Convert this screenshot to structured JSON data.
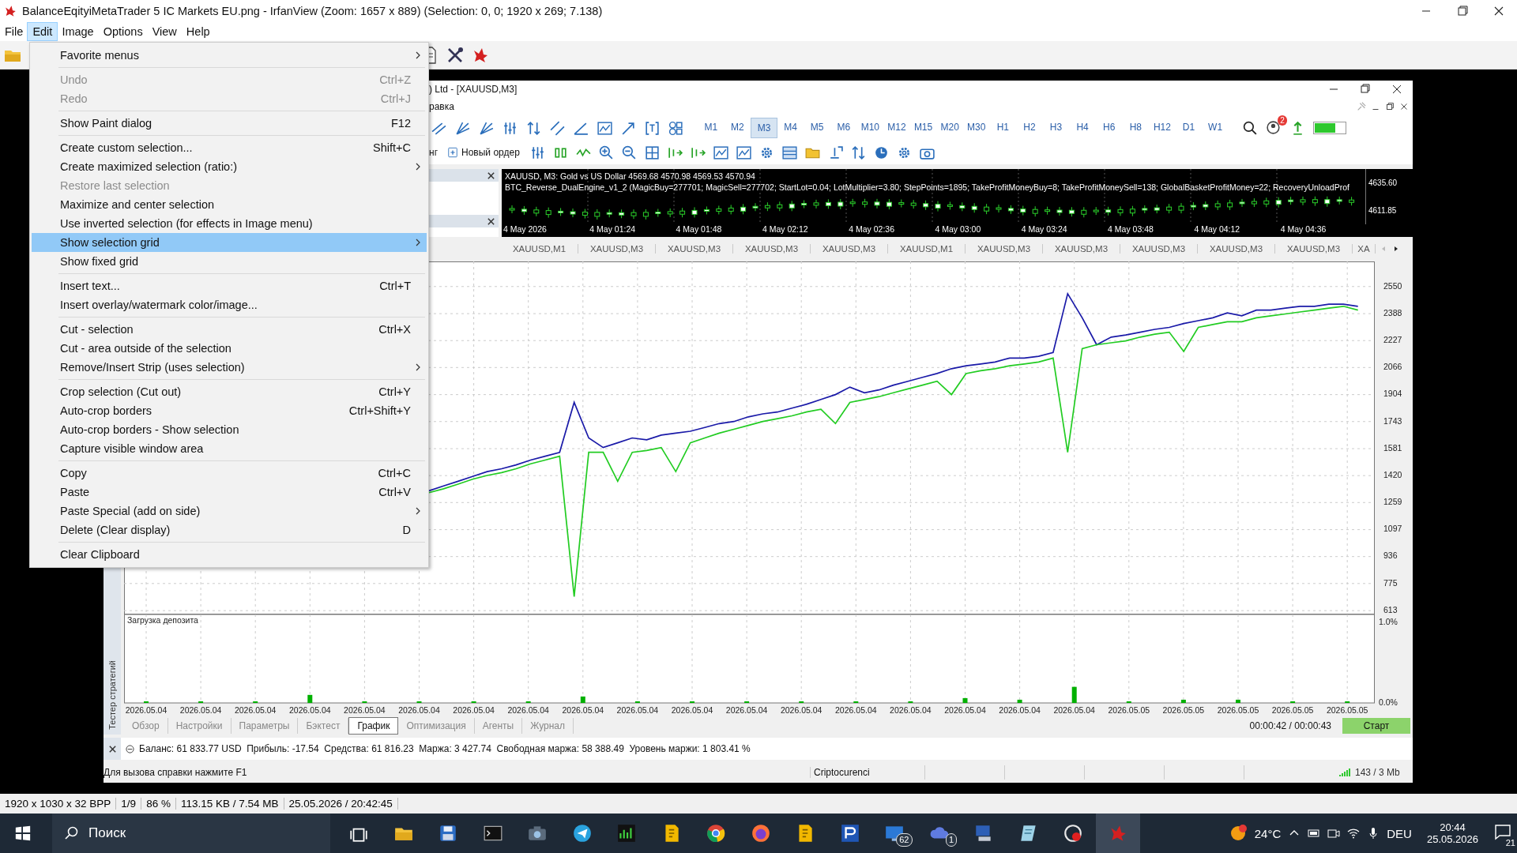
{
  "window": {
    "title": "BalanceEqityiMetaTrader 5 IC Markets EU.png - IrfanView (Zoom: 1657 x 889) (Selection: 0, 0; 1920 x 269; 7.138)"
  },
  "menu": [
    {
      "label": "File",
      "selected": false
    },
    {
      "label": "Edit",
      "selected": true
    },
    {
      "label": "Image",
      "selected": false
    },
    {
      "label": "Options",
      "selected": false
    },
    {
      "label": "View",
      "selected": false
    },
    {
      "label": "Help",
      "selected": false
    }
  ],
  "edit_menu": [
    {
      "kind": "item",
      "label": "Favorite menus",
      "submenu": true,
      "disabled": false,
      "selected": false
    },
    {
      "kind": "separator"
    },
    {
      "kind": "item",
      "label": "Undo",
      "shortcut": "Ctrl+Z",
      "submenu": false,
      "disabled": true,
      "selected": false
    },
    {
      "kind": "item",
      "label": "Redo",
      "shortcut": "Ctrl+J",
      "submenu": false,
      "disabled": true,
      "selected": false
    },
    {
      "kind": "separator"
    },
    {
      "kind": "item",
      "label": "Show Paint dialog",
      "shortcut": "F12",
      "submenu": false,
      "disabled": false,
      "selected": false
    },
    {
      "kind": "separator"
    },
    {
      "kind": "item",
      "label": "Create custom selection...",
      "shortcut": "Shift+C",
      "submenu": false,
      "disabled": false,
      "selected": false
    },
    {
      "kind": "item",
      "label": "Create maximized selection (ratio:)",
      "submenu": true,
      "disabled": false,
      "selected": false
    },
    {
      "kind": "item",
      "label": "Restore last selection",
      "submenu": false,
      "disabled": true,
      "selected": false
    },
    {
      "kind": "item",
      "label": "Maximize and center selection",
      "submenu": false,
      "disabled": false,
      "selected": false
    },
    {
      "kind": "item",
      "label": "Use inverted selection (for effects in Image menu)",
      "submenu": false,
      "disabled": false,
      "selected": false
    },
    {
      "kind": "item",
      "label": "Show selection grid",
      "submenu": true,
      "disabled": false,
      "selected": true
    },
    {
      "kind": "item",
      "label": "Show fixed grid",
      "submenu": false,
      "disabled": false,
      "selected": false
    },
    {
      "kind": "separator"
    },
    {
      "kind": "item",
      "label": "Insert text...",
      "shortcut": "Ctrl+T",
      "submenu": false,
      "disabled": false,
      "selected": false
    },
    {
      "kind": "item",
      "label": "Insert overlay/watermark color/image...",
      "submenu": false,
      "disabled": false,
      "selected": false
    },
    {
      "kind": "separator"
    },
    {
      "kind": "item",
      "label": "Cut - selection",
      "shortcut": "Ctrl+X",
      "submenu": false,
      "disabled": false,
      "selected": false
    },
    {
      "kind": "item",
      "label": "Cut - area outside of the selection",
      "submenu": false,
      "disabled": false,
      "selected": false
    },
    {
      "kind": "item",
      "label": "Remove/Insert Strip (uses selection)",
      "submenu": true,
      "disabled": false,
      "selected": false
    },
    {
      "kind": "separator"
    },
    {
      "kind": "item",
      "label": "Crop selection (Cut out)",
      "shortcut": "Ctrl+Y",
      "submenu": false,
      "disabled": false,
      "selected": false
    },
    {
      "kind": "item",
      "label": "Auto-crop borders",
      "shortcut": "Ctrl+Shift+Y",
      "submenu": false,
      "disabled": false,
      "selected": false
    },
    {
      "kind": "item",
      "label": "Auto-crop borders - Show selection",
      "submenu": false,
      "disabled": false,
      "selected": false
    },
    {
      "kind": "item",
      "label": "Capture visible window area",
      "submenu": false,
      "disabled": false,
      "selected": false
    },
    {
      "kind": "separator"
    },
    {
      "kind": "item",
      "label": "Copy",
      "shortcut": "Ctrl+C",
      "submenu": false,
      "disabled": false,
      "selected": false
    },
    {
      "kind": "item",
      "label": "Paste",
      "shortcut": "Ctrl+V",
      "submenu": false,
      "disabled": false,
      "selected": false
    },
    {
      "kind": "item",
      "label": "Paste Special (add on side)",
      "submenu": true,
      "disabled": false,
      "selected": false
    },
    {
      "kind": "item",
      "label": "Delete (Clear display)",
      "shortcut": "D",
      "submenu": false,
      "disabled": false,
      "selected": false
    },
    {
      "kind": "separator"
    },
    {
      "kind": "item",
      "label": "Clear Clipboard",
      "submenu": false,
      "disabled": false,
      "selected": false
    }
  ],
  "image": {
    "title": ") Ltd - [XAUUSD,M3]",
    "menu_fragment": "равка",
    "timeframes": [
      {
        "label": "M1",
        "selected": false
      },
      {
        "label": "M2",
        "selected": false
      },
      {
        "label": "M3",
        "selected": true
      },
      {
        "label": "M4",
        "selected": false
      },
      {
        "label": "M5",
        "selected": false
      },
      {
        "label": "M6",
        "selected": false
      },
      {
        "label": "M10",
        "selected": false
      },
      {
        "label": "M12",
        "selected": false
      },
      {
        "label": "M15",
        "selected": false
      },
      {
        "label": "M20",
        "selected": false
      },
      {
        "label": "M30",
        "selected": false
      },
      {
        "label": "H1",
        "selected": false
      },
      {
        "label": "H2",
        "selected": false
      },
      {
        "label": "H3",
        "selected": false
      },
      {
        "label": "H4",
        "selected": false
      },
      {
        "label": "H6",
        "selected": false
      },
      {
        "label": "H8",
        "selected": false
      },
      {
        "label": "H12",
        "selected": false
      },
      {
        "label": "D1",
        "selected": false
      },
      {
        "label": "W1",
        "selected": false
      }
    ],
    "notification_badge": "2",
    "toolbar_fragment": "нг",
    "new_order_button": "Новый ордер",
    "mini_chart": {
      "header": "XAUUSD, M3:  Gold vs US Dollar  4569.68 4570.98 4569.53 4570.94",
      "expert": "BTC_Reverse_DualEngine_v1_2 (MagicBuy=277701; MagicSell=277702; StartLot=0.04; LotMultiplier=3.80; StepPoints=1895; TakeProfitMoneyBuy=8; TakeProfitMoneySell=138; GlobalBasketProfitMoney=22; RecoveryUnloadProf",
      "prices": [
        "4635.60",
        "4611.85"
      ],
      "times": [
        "4 May 2026",
        "4 May 01:24",
        "4 May 01:48",
        "4 May 02:12",
        "4 May 02:36",
        "4 May 03:00",
        "4 May 03:24",
        "4 May 03:48",
        "4 May 04:12",
        "4 May 04:36"
      ]
    },
    "chart_tabs": [
      "XAUUSD,M1",
      "XAUUSD,M3",
      "XAUUSD,M3",
      "XAUUSD,M3",
      "XAUUSD,M3",
      "XAUUSD,M1",
      "XAUUSD,M3",
      "XAUUSD,M3",
      "XAUUSD,M3",
      "XAUUSD,M3",
      "XAUUSD,M3",
      "XA"
    ],
    "balance_chart": {
      "chart_data": {
        "type": "line",
        "grid": true,
        "ylim": [
          590,
          2700
        ],
        "yticks": [
          613,
          775,
          936,
          1097,
          1259,
          1420,
          1581,
          1743,
          1904,
          2066,
          2227,
          2388,
          2550
        ],
        "series": [
          {
            "color": "#1a1aa8",
            "values": [
              1329,
              1358,
              1386,
              1415,
              1444,
              1461,
              1484,
              1513,
              1536,
              1559,
              1858,
              1645,
              1588,
              1616,
              1645,
              1634,
              1662,
              1674,
              1685,
              1708,
              1731,
              1743,
              1771,
              1789,
              1800,
              1823,
              1846,
              1875,
              1904,
              1949,
              1915,
              1932,
              1961,
              1984,
              2007,
              2030,
              2059,
              2076,
              2087,
              2099,
              2122,
              2122,
              2133,
              2156,
              2507,
              2363,
              2202,
              2248,
              2260,
              2277,
              2294,
              2306,
              2329,
              2346,
              2363,
              2392,
              2375,
              2409,
              2409,
              2421,
              2432,
              2432,
              2444,
              2444,
              2432
            ]
          },
          {
            "color": "#22cc22",
            "values": [
              1318,
              1341,
              1369,
              1398,
              1421,
              1438,
              1461,
              1490,
              1513,
              1536,
              697,
              1559,
              1559,
              1386,
              1559,
              1570,
              1588,
              1444,
              1616,
              1645,
              1674,
              1697,
              1720,
              1743,
              1760,
              1777,
              1800,
              1817,
              1731,
              1858,
              1875,
              1892,
              1915,
              1938,
              1961,
              1984,
              1904,
              2030,
              2047,
              2059,
              2076,
              2087,
              2099,
              2122,
              1559,
              2179,
              2202,
              2214,
              2225,
              2248,
              2265,
              2277,
              2162,
              2306,
              2323,
              2340,
              2340,
              2363,
              2375,
              2386,
              2398,
              2409,
              2421,
              2432,
              2409
            ]
          }
        ]
      }
    },
    "deposit_chart": {
      "title": "Загрузка депозита",
      "chart_data": {
        "type": "bar",
        "grid": true,
        "ylim": [
          0,
          1.1
        ],
        "yticks": [
          {
            "value": 0,
            "label": "0.0%"
          },
          {
            "value": 1,
            "label": "1.0%"
          }
        ],
        "categories": [
          "2026.05.04",
          "2026.05.04",
          "2026.05.04",
          "2026.05.04",
          "2026.05.04",
          "2026.05.04",
          "2026.05.04",
          "2026.05.04",
          "2026.05.04",
          "2026.05.04",
          "2026.05.04",
          "2026.05.04",
          "2026.05.04",
          "2026.05.04",
          "2026.05.04",
          "2026.05.04",
          "2026.05.04",
          "2026.05.04",
          "2026.05.05",
          "2026.05.05",
          "2026.05.05",
          "2026.05.05",
          "2026.05.05"
        ],
        "series": [
          {
            "color": "#00b000",
            "values": [
              0.02,
              0.02,
              0.02,
              0.1,
              0.02,
              0.02,
              0.02,
              0.02,
              0.08,
              0.02,
              0.02,
              0.02,
              0.02,
              0.02,
              0.02,
              0.06,
              0.04,
              0.2,
              0.02,
              0.04,
              0.04,
              0.02,
              0.02
            ]
          }
        ]
      }
    },
    "side_tab": "Тестер стратегий",
    "tester_tabs": [
      {
        "label": "Обзор",
        "selected": false
      },
      {
        "label": "Настройки",
        "selected": false
      },
      {
        "label": "Параметры",
        "selected": false
      },
      {
        "label": "Бэктест",
        "selected": false
      },
      {
        "label": "График",
        "selected": true
      },
      {
        "label": "Оптимизация",
        "selected": false
      },
      {
        "label": "Агенты",
        "selected": false
      },
      {
        "label": "Журнал",
        "selected": false
      }
    ],
    "elapsed": "00:00:42 / 00:00:43",
    "start_button": "Старт",
    "account": "Баланс: 61 833.77 USD  Прибыль: -17.54  Средства: 61 816.23  Маржа: 3 427.74  Свободная маржа: 58 388.49  Уровень маржи: 1 803.41 %",
    "status": {
      "help": "Для вызова справки нажмите F1",
      "profile": "Criptocurenci",
      "traffic": "143 / 3 Mb"
    }
  },
  "status_bar": [
    "1920 x 1030 x 32 BPP",
    "1/9",
    "86 %",
    "113.15 KB / 7.54 MB",
    "25.05.2026 / 20:42:45"
  ],
  "taskbar": {
    "search": {
      "placeholder": "Поиск"
    },
    "apps": [
      {
        "selected": false
      },
      {
        "selected": false
      },
      {
        "selected": false
      },
      {
        "selected": false
      },
      {
        "selected": false
      },
      {
        "selected": false
      },
      {
        "selected": false
      },
      {
        "selected": false
      },
      {
        "selected": false
      },
      {
        "selected": false
      },
      {
        "selected": false
      },
      {
        "selected": false
      },
      {
        "selected": false,
        "badge": "62"
      },
      {
        "selected": false,
        "badge": "1"
      },
      {
        "selected": false
      },
      {
        "selected": false
      },
      {
        "selected": false
      },
      {
        "selected": true
      }
    ],
    "weather": "24°C",
    "language": "DEU",
    "time": "20:44",
    "date": "25.05.2026",
    "notifications": "21"
  }
}
